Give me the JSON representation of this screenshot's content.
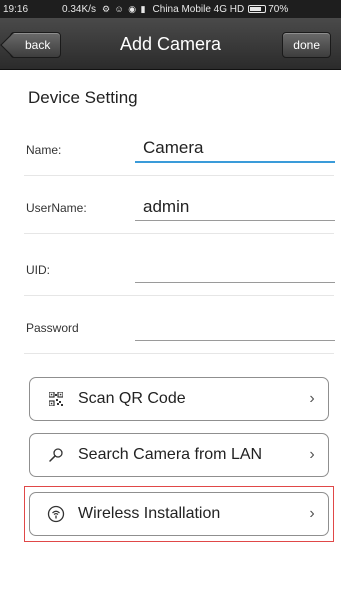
{
  "status_bar": {
    "time": "19:16",
    "speed": "0.34K/s",
    "icons": "⚙ ☺ ◉ ▮",
    "carrier": "China Mobile 4G HD",
    "battery": "70%",
    "battery_level": 0.7
  },
  "nav": {
    "back_label": "back",
    "title": "Add Camera",
    "done_label": "done"
  },
  "section": {
    "title": "Device Setting"
  },
  "form": {
    "name_label": "Name:",
    "name_value": "Camera",
    "username_label": "UserName:",
    "username_value": "admin",
    "uid_label": "UID:",
    "uid_value": "",
    "password_label": "Password",
    "password_value": ""
  },
  "actions": {
    "scan_label": "Scan QR Code",
    "search_label": "Search Camera from LAN",
    "wireless_label": "Wireless Installation",
    "chevron": "›"
  },
  "colors": {
    "accent": "#3a9bd9",
    "highlight": "#e04848",
    "navbar": "#3a3a3a"
  }
}
